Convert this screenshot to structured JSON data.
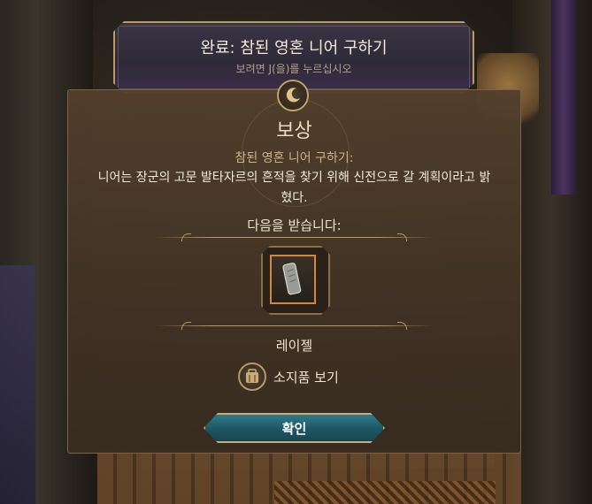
{
  "banner": {
    "title": "완료: 참된 영혼 니어 구하기",
    "hint": "보려면 J(을)를 누르십시오"
  },
  "reward": {
    "heading": "보상",
    "quest_name": "참된 영혼 니어 구하기:",
    "description": "니어는 장군의 고문 발타자르의 흔적을 찾기 위해 신전으로 갈 계획이라고 밝혔다.",
    "receive_label": "다음을 받습니다:",
    "item_icon": "scroll-item-icon",
    "character_name": "레이젤",
    "inventory_label": "소지품 보기",
    "confirm_label": "확인"
  },
  "colors": {
    "accent_gold": "#b79a68",
    "button_teal": "#1d5663",
    "item_border": "#d4873b",
    "panel_bg": "#4a3a2a"
  }
}
